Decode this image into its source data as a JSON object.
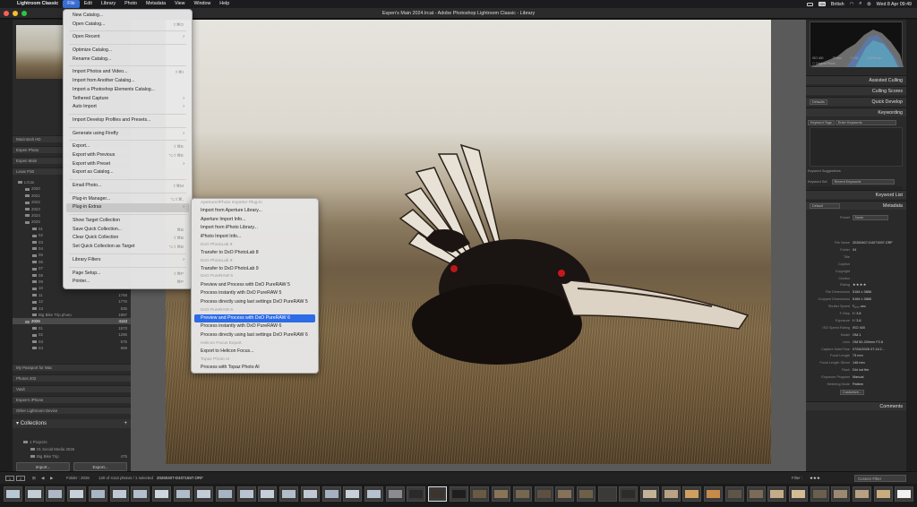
{
  "menubar": {
    "apple": "",
    "app": "Lightroom Classic",
    "items": [
      "File",
      "Edit",
      "Library",
      "Photo",
      "Metadata",
      "View",
      "Window",
      "Help"
    ],
    "user_badge": "British",
    "clock": "Wed 8 Apr  09:49"
  },
  "window": {
    "title": "Espen's Main 2024.lrcat - Adobe Photoshop Lightroom Classic - Library"
  },
  "file_menu": {
    "items": [
      {
        "label": "New Catalog...",
        "shortcut": "",
        "submenu": false
      },
      {
        "label": "Open Catalog...",
        "shortcut": "⇧⌘O",
        "submenu": false
      },
      {
        "sep": true
      },
      {
        "label": "Open Recent",
        "shortcut": "",
        "submenu": true
      },
      {
        "sep": true
      },
      {
        "label": "Optimize Catalog...",
        "shortcut": "",
        "submenu": false
      },
      {
        "label": "Rename Catalog...",
        "shortcut": "",
        "submenu": false
      },
      {
        "sep": true
      },
      {
        "label": "Import Photos and Video...",
        "shortcut": "⇧⌘I",
        "submenu": false
      },
      {
        "label": "Import from Another Catalog...",
        "shortcut": "",
        "submenu": false
      },
      {
        "label": "Import a Photoshop Elements Catalog...",
        "shortcut": "",
        "submenu": false
      },
      {
        "label": "Tethered Capture",
        "shortcut": "",
        "submenu": true
      },
      {
        "label": "Auto Import",
        "shortcut": "",
        "submenu": true
      },
      {
        "sep": true
      },
      {
        "label": "Import Develop Profiles and Presets...",
        "shortcut": "",
        "submenu": false
      },
      {
        "sep": true
      },
      {
        "label": "Generate using Firefly",
        "shortcut": "",
        "submenu": true
      },
      {
        "sep": true
      },
      {
        "label": "Export...",
        "shortcut": "⇧⌘E",
        "submenu": false
      },
      {
        "label": "Export with Previous",
        "shortcut": "⌥⇧⌘E",
        "submenu": false
      },
      {
        "label": "Export with Preset",
        "shortcut": "",
        "submenu": true
      },
      {
        "label": "Export as Catalog...",
        "shortcut": "",
        "submenu": false
      },
      {
        "sep": true
      },
      {
        "label": "Email Photo...",
        "shortcut": "⇧⌘M",
        "submenu": false
      },
      {
        "sep": true
      },
      {
        "label": "Plug-in Manager...",
        "shortcut": "⌥⇧⌘,",
        "submenu": false
      },
      {
        "label": "Plug-in Extras",
        "shortcut": "",
        "submenu": true,
        "highlight": true
      },
      {
        "sep": true
      },
      {
        "label": "Show Target Collection",
        "shortcut": "",
        "submenu": false
      },
      {
        "label": "Save Quick Collection...",
        "shortcut": "⌘B",
        "submenu": false
      },
      {
        "label": "Clear Quick Collection",
        "shortcut": "⇧⌘B",
        "submenu": false
      },
      {
        "label": "Set Quick Collection as Target",
        "shortcut": "⌥⇧⌘B",
        "submenu": false
      },
      {
        "sep": true
      },
      {
        "label": "Library Filters",
        "shortcut": "",
        "submenu": true
      },
      {
        "sep": true
      },
      {
        "label": "Page Setup...",
        "shortcut": "⇧⌘P",
        "submenu": false
      },
      {
        "label": "Printer...",
        "shortcut": "⌘P",
        "submenu": false
      }
    ]
  },
  "plugin_extras_menu": {
    "items": [
      {
        "head": "Aperture/iPhoto Importer Plug-in"
      },
      {
        "label": "Import from Aperture Library..."
      },
      {
        "label": "Aperture Import Info..."
      },
      {
        "label": "Import from iPhoto Library..."
      },
      {
        "label": "iPhoto Import Info..."
      },
      {
        "head": "DxO PhotoLab 8"
      },
      {
        "label": "Transfer to DxO PhotoLab 8"
      },
      {
        "head": "DxO PhotoLab 9"
      },
      {
        "label": "Transfer to DxO PhotoLab 9"
      },
      {
        "head": "DxO PureRAW 5"
      },
      {
        "label": "Preview and Process with DxO PureRAW 5"
      },
      {
        "label": "Process instantly with DxO PureRAW 5"
      },
      {
        "label": "Process directly using last settings DxO PureRAW 5"
      },
      {
        "head": "DxO PureRAW 6"
      },
      {
        "label": "Preview and Process with DxO PureRAW 6",
        "highlight": true
      },
      {
        "label": "Process instantly with DxO PureRAW 6"
      },
      {
        "label": "Process directly using last settings DxO PureRAW 6"
      },
      {
        "head": "Helicon Focus Export"
      },
      {
        "label": "Export to Helicon Focus..."
      },
      {
        "head": "Topaz Photo AI"
      },
      {
        "label": "Process with Topaz Photo AI"
      }
    ]
  },
  "left_panel": {
    "volumes": [
      "Macintosh HD",
      "Espen Photo",
      "Espen Main",
      "Lexar P30"
    ],
    "tree": [
      {
        "label": "LrCat",
        "count": ""
      },
      {
        "label": "2020",
        "count": ""
      },
      {
        "label": "2021",
        "count": ""
      },
      {
        "label": "2022",
        "count": ""
      },
      {
        "label": "2023",
        "count": ""
      },
      {
        "label": "2024",
        "count": ""
      },
      {
        "label": "2025",
        "count": ""
      },
      {
        "label": "01",
        "count": ""
      },
      {
        "label": "02",
        "count": ""
      },
      {
        "label": "03",
        "count": ""
      },
      {
        "label": "04",
        "count": ""
      },
      {
        "label": "05",
        "count": ""
      },
      {
        "label": "06",
        "count": ""
      },
      {
        "label": "07",
        "count": ""
      },
      {
        "label": "08",
        "count": ""
      },
      {
        "label": "09",
        "count": ""
      },
      {
        "label": "10",
        "count": "1529"
      },
      {
        "label": "11",
        "count": "1768"
      },
      {
        "label": "12",
        "count": "1776"
      },
      {
        "label": "13",
        "count": "835"
      },
      {
        "label": "Big Bike Trip photo",
        "count": "1997"
      },
      {
        "label": "2026",
        "count": "4113",
        "selected": true
      },
      {
        "label": "01",
        "count": "1573"
      },
      {
        "label": "02",
        "count": "1296"
      },
      {
        "label": "03",
        "count": "575"
      },
      {
        "label": "04",
        "count": "669"
      }
    ],
    "other_volumes": [
      "My Passport for Mac",
      "Photos 202",
      "Vault",
      "Espen's iPhone",
      "Other Lightroom Device"
    ],
    "collections_title": "Collections",
    "collections": [
      {
        "label": "1 Projects",
        "count": ""
      },
      {
        "label": "01 Social Media 2026",
        "count": ""
      },
      {
        "label": "Big Bike Trip",
        "count": "475"
      }
    ],
    "import_label": "Import...",
    "export_label": "Export..."
  },
  "right_panel": {
    "histogram_info": "Original Photo",
    "histogram_labels": [
      "ISO 400",
      "73 mm",
      "f / 3.8",
      "1/1000 sec"
    ],
    "sections": {
      "assisted_culling": "Assisted Culling",
      "culling_scores": "Culling Scores",
      "quick_develop": "Quick Develop",
      "keywording": "Keywording",
      "keyword_list": "Keyword List",
      "metadata": "Metadata",
      "comments": "Comments"
    },
    "early_access": "Early Access",
    "qd_preset": "Defaults",
    "keyword_tags_label": "Keyword Tags",
    "keyword_tags_value": "Enter Keywords",
    "keyword_suggestions": "Keyword Suggestions",
    "keyword_set_label": "Keyword Set",
    "keyword_set_value": "Recent Keywords",
    "metadata_preset_label": "Default",
    "preset_label": "Preset",
    "preset_value": "None",
    "customize_label": "Customize...",
    "metadata": [
      {
        "k": "File Name",
        "v": "20260407-D4071597.ORF"
      },
      {
        "k": "Folder",
        "v": "04"
      },
      {
        "k": "Title",
        "v": ""
      },
      {
        "k": "Caption",
        "v": ""
      },
      {
        "k": "Copyright",
        "v": ""
      },
      {
        "k": "Creator",
        "v": ""
      },
      {
        "k": "Rating",
        "v": "★★★★"
      },
      {
        "k": "File Dimensions",
        "v": "5184 x 3888"
      },
      {
        "k": "Cropped Dimensions",
        "v": "5184 x 3888"
      },
      {
        "k": "Shutter Speed",
        "v": "¹⁄₁₀₀₀ sec"
      },
      {
        "k": "F-Stop",
        "v": "f / 3.8"
      },
      {
        "k": "Exposure",
        "v": "f / 3.8"
      },
      {
        "k": "ISO Speed Rating",
        "v": "ISO 400"
      },
      {
        "k": "Model",
        "v": "OM-1"
      },
      {
        "k": "Lens",
        "v": "OM 50-200mm F2.8"
      },
      {
        "k": "Capture Date/Time",
        "v": "07/04/2026 07:14:2..."
      },
      {
        "k": "Focal Length",
        "v": "73 mm"
      },
      {
        "k": "Focal Length 35mm",
        "v": "146 mm"
      },
      {
        "k": "Flash",
        "v": "Did not fire"
      },
      {
        "k": "Exposure Program",
        "v": "Manual"
      },
      {
        "k": "Metering Mode",
        "v": "Pattern"
      }
    ]
  },
  "toolbar": {
    "folder_text": "Folder : 2026",
    "count_text": "120 of 4113 photos / 1 selected",
    "filename": "20260407-D4071597.ORF",
    "filter_label": "Filter :",
    "filter_value": "Custom Filter",
    "filter_stars": "★★★"
  },
  "colors": {
    "menu_highlight": "#2e6be6",
    "panel_bg": "#2a2a2a",
    "menubar_active": "#3a6fd6"
  }
}
